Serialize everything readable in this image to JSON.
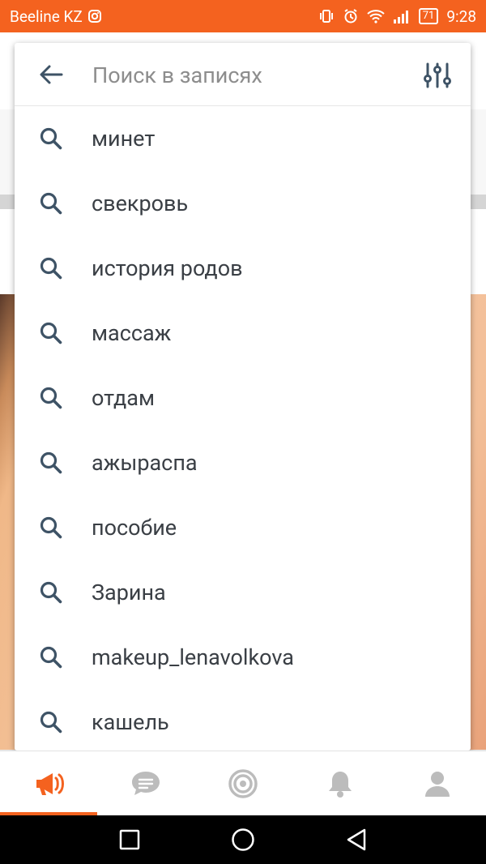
{
  "status_bar": {
    "carrier": "Beeline KZ",
    "battery": "71",
    "time": "9:28"
  },
  "search": {
    "placeholder": "Поиск в записях",
    "value": ""
  },
  "suggestions": [
    "минет",
    "свекровь",
    "история родов",
    "массаж",
    "отдам",
    "ажыраспа",
    "пособие",
    "Зарина",
    "makeup_lenavolkova",
    "кашель"
  ],
  "colors": {
    "accent": "#f4621f",
    "icon_dark": "#3e5366",
    "icon_inactive": "#bcbcbc"
  },
  "bottom_nav": [
    {
      "name": "feed",
      "icon": "megaphone-icon",
      "active": true
    },
    {
      "name": "chats",
      "icon": "chat-bubble-icon",
      "active": false
    },
    {
      "name": "targets",
      "icon": "target-icon",
      "active": false
    },
    {
      "name": "notifications",
      "icon": "bell-icon",
      "active": false
    },
    {
      "name": "profile",
      "icon": "user-icon",
      "active": false
    }
  ]
}
